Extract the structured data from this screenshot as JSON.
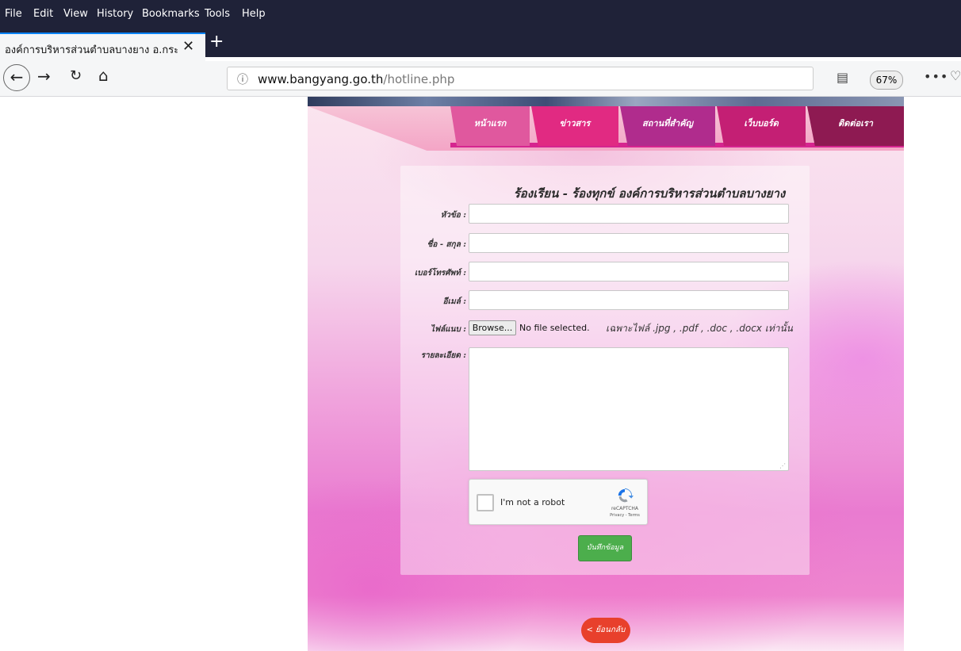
{
  "browser": {
    "menu": [
      "File",
      "Edit",
      "View",
      "History",
      "Bookmarks",
      "Tools",
      "Help"
    ],
    "tab_title": "องค์การบริหารส่วนตำบลบางยาง อ.กระ",
    "url_host": "www.bangyang.go.th",
    "url_path": "/hotline.php",
    "zoom": "67%",
    "more": "•••"
  },
  "site": {
    "nav": [
      "หน้าแรก",
      "ข่าวสาร",
      "สถานที่สำคัญ",
      "เว็บบอร์ด",
      "ติดต่อเรา"
    ],
    "form_title": "ร้องเรียน - ร้องทุกข์ องค์การบริหารส่วนตำบลบางยาง",
    "labels": {
      "subject": "หัวข้อ :",
      "name": "ชื่อ - สกุล :",
      "phone": "เบอร์โทรศัพท์ :",
      "email": "อีเมล์ :",
      "attachment": "ไฟล์แนบ :",
      "details": "รายละเอียด :"
    },
    "browse_label": "Browse...",
    "no_file": "No file selected.",
    "file_hint": "เฉพาะไฟล์ .jpg , .pdf , .doc , .docx เท่านั้น",
    "captcha_text": "I'm not a robot",
    "captcha_brand": "reCAPTCHA",
    "captcha_terms": "Privacy - Terms",
    "save_label": "บันทึกข้อมูล",
    "back_label": "< ย้อนกลับ"
  },
  "colors": {
    "nav_tabs": [
      "#e0589e",
      "#e12a82",
      "#b02c8d",
      "#c41f74",
      "#8e1a52"
    ],
    "save_button": "#4cae4c",
    "back_button": "#e8402c"
  }
}
